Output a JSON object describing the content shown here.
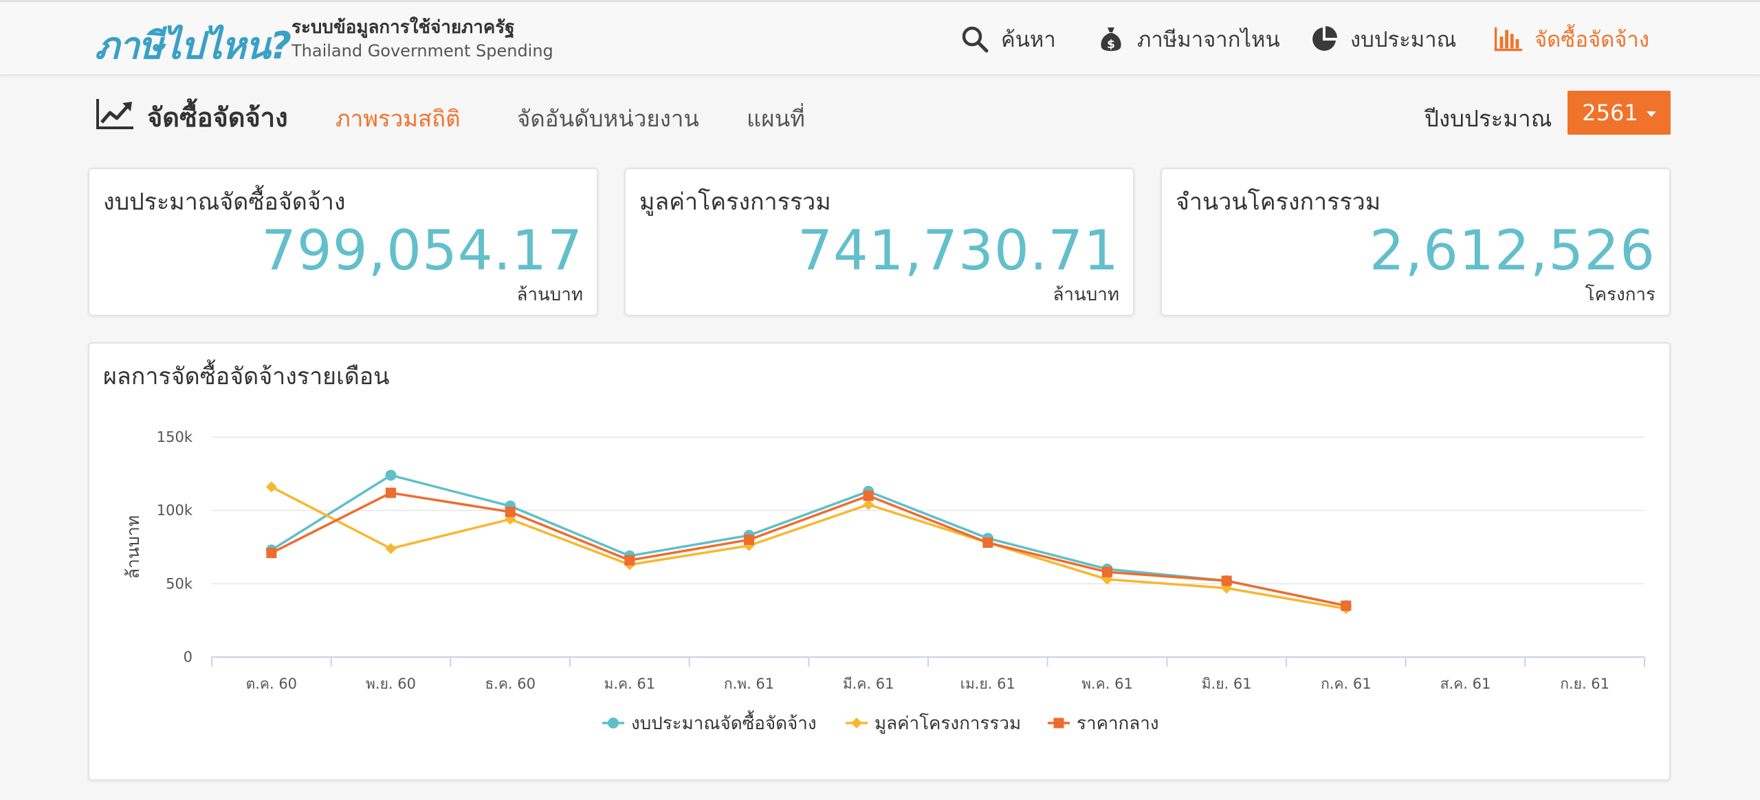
{
  "header": {
    "logo": "ภาษีไปไหน?",
    "tagline_th": "ระบบข้อมูลการใช้จ่ายภาครัฐ",
    "tagline_en": "Thailand Government Spending",
    "nav": [
      {
        "label": "ค้นหา",
        "icon": "search-icon"
      },
      {
        "label": "ภาษีมาจากไหน",
        "icon": "money-bag-icon"
      },
      {
        "label": "งบประมาณ",
        "icon": "pie-chart-icon"
      },
      {
        "label": "จัดซื้อจัดจ้าง",
        "icon": "bar-chart-icon",
        "active": true
      }
    ]
  },
  "subnav": {
    "title": "จัดซื้อจัดจ้าง",
    "tabs": [
      {
        "label": "ภาพรวมสถิติ",
        "active": true
      },
      {
        "label": "จัดอันดับหน่วยงาน"
      },
      {
        "label": "แผนที่"
      }
    ],
    "year_label": "ปีงบประมาณ",
    "year_value": "2561"
  },
  "cards": [
    {
      "label": "งบประมาณจัดซื้อจัดจ้าง",
      "value": "799,054.17",
      "unit": "ล้านบาท"
    },
    {
      "label": "มูลค่าโครงการรวม",
      "value": "741,730.71",
      "unit": "ล้านบาท"
    },
    {
      "label": "จำนวนโครงการรวม",
      "value": "2,612,526",
      "unit": "โครงการ"
    }
  ],
  "colors": {
    "accent": "#f0732b",
    "brand": "#3aa0c6",
    "stat_value": "#62bfcb",
    "series_budget": "#5fbfc9",
    "series_project": "#f7b731",
    "series_median": "#ee6c2e"
  },
  "chart_panel": {
    "title": "ผลการจัดซื้อจัดจ้างรายเดือน"
  },
  "chart_data": {
    "type": "line",
    "categories": [
      "ต.ค. 60",
      "พ.ย. 60",
      "ธ.ค. 60",
      "ม.ค. 61",
      "ก.พ. 61",
      "มี.ค. 61",
      "เม.ย. 61",
      "พ.ค. 61",
      "มิ.ย. 61",
      "ก.ค. 61",
      "ส.ค. 61",
      "ก.ย. 61"
    ],
    "ylabel": "ล้านบาท",
    "ylim": [
      0,
      150000
    ],
    "yticks": [
      0,
      50000,
      100000,
      150000
    ],
    "ytick_labels": [
      "0",
      "50k",
      "100k",
      "150k"
    ],
    "grid": true,
    "legend": "bottom",
    "series": [
      {
        "name": "งบประมาณจัดซื้อจัดจ้าง",
        "color": "#5fbfc9",
        "marker": "circle",
        "values": [
          73000,
          124000,
          103000,
          69000,
          83000,
          113000,
          81000,
          60000,
          52000,
          35000,
          null,
          null
        ]
      },
      {
        "name": "มูลค่าโครงการรวม",
        "color": "#f7b731",
        "marker": "diamond",
        "values": [
          116000,
          74000,
          94000,
          63000,
          76000,
          104000,
          78000,
          53000,
          47000,
          33000,
          null,
          null
        ]
      },
      {
        "name": "ราคากลาง",
        "color": "#ee6c2e",
        "marker": "square",
        "values": [
          71000,
          112000,
          99000,
          66000,
          80000,
          110000,
          78000,
          58000,
          52000,
          35000,
          null,
          null
        ]
      }
    ]
  }
}
